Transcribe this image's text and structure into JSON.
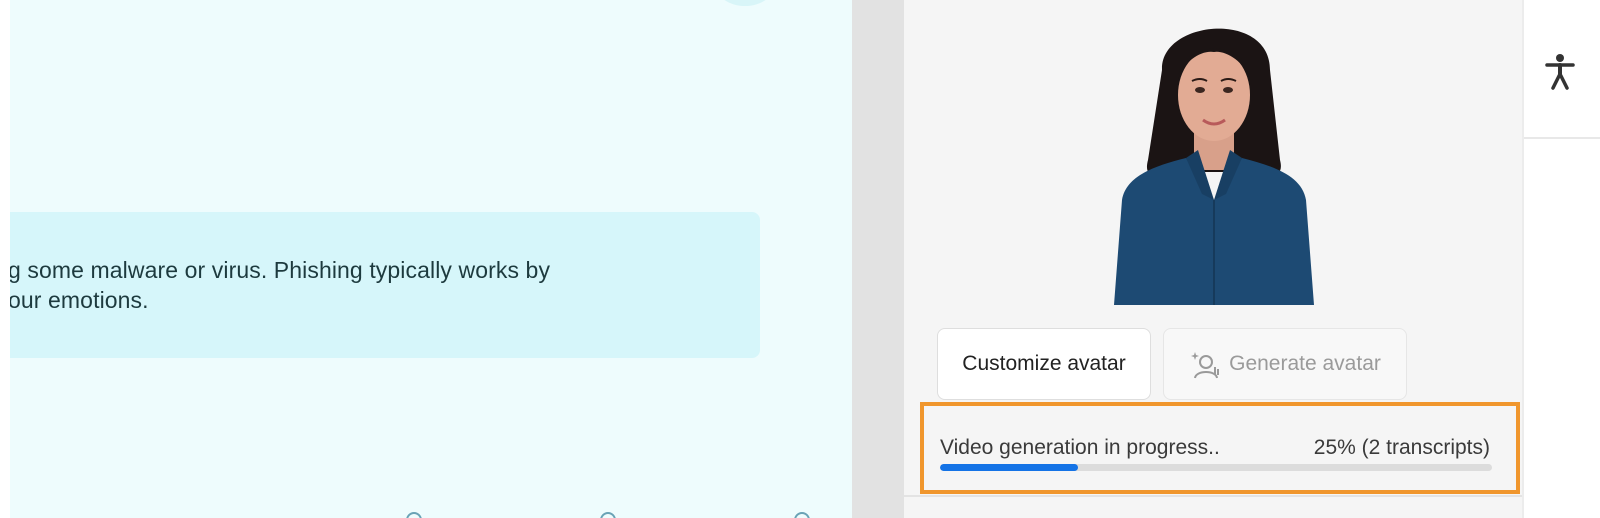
{
  "slide": {
    "text_line_1": "g some malware or virus. Phishing typically works by",
    "text_line_2": "our emotions."
  },
  "avatar_panel": {
    "customize_label": "Customize avatar",
    "generate_label": "Generate avatar",
    "progress": {
      "status": "Video generation in progress..",
      "percent_text": "25% (2 transcripts)",
      "fraction": 0.25
    }
  },
  "icons": {
    "generate": "sparkle-avatar-icon",
    "rail": "accessibility-icon"
  },
  "colors": {
    "accent": "#1473e6",
    "highlight_border": "#f0962d",
    "slide_background": "#eefcfd",
    "callout_background": "#d6f6fa"
  }
}
